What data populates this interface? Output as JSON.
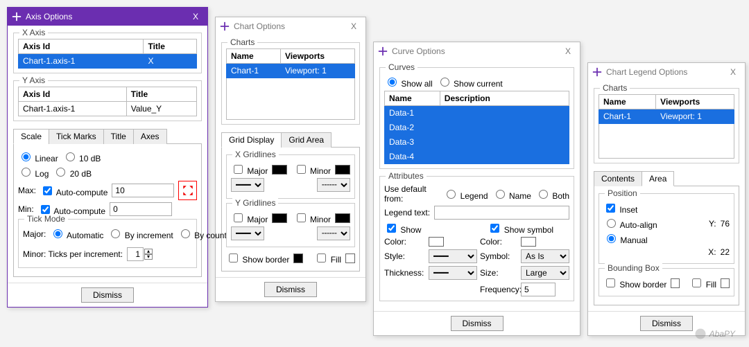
{
  "axis": {
    "title": "Axis Options",
    "close": "X",
    "xaxis": {
      "label": "X Axis",
      "headers": [
        "Axis Id",
        "Title"
      ],
      "row": {
        "id": "Chart-1.axis-1",
        "title": "X"
      }
    },
    "yaxis": {
      "label": "Y Axis",
      "headers": [
        "Axis Id",
        "Title"
      ],
      "row": {
        "id": "Chart-1.axis-1",
        "title": "Value_Y"
      }
    },
    "tabs": [
      "Scale",
      "Tick Marks",
      "Title",
      "Axes"
    ],
    "scale": {
      "linear": "Linear",
      "db10": "10 dB",
      "log": "Log",
      "db20": "20 dB",
      "max": "Max:",
      "min": "Min:",
      "auto": "Auto-compute",
      "maxval": "10",
      "minval": "0"
    },
    "tickmode": {
      "label": "Tick Mode",
      "major": "Major:",
      "automatic": "Automatic",
      "byinc": "By increment",
      "bycount": "By count",
      "minor": "Minor: Ticks per increment:",
      "minorval": "1"
    },
    "dismiss": "Dismiss"
  },
  "chart": {
    "title": "Chart Options",
    "close": "X",
    "charts": {
      "label": "Charts",
      "headers": [
        "Name",
        "Viewports"
      ],
      "row": {
        "name": "Chart-1",
        "vp": "Viewport: 1"
      }
    },
    "gtabs": [
      "Grid Display",
      "Grid Area"
    ],
    "xg": {
      "label": "X Gridlines",
      "major": "Major",
      "minor": "Minor"
    },
    "yg": {
      "label": "Y Gridlines",
      "major": "Major",
      "minor": "Minor"
    },
    "showborder": "Show border",
    "fill": "Fill",
    "dismiss": "Dismiss"
  },
  "curve": {
    "title": "Curve Options",
    "close": "X",
    "curves": {
      "label": "Curves",
      "showall": "Show all",
      "showcurrent": "Show current",
      "headers": [
        "Name",
        "Description"
      ],
      "rows": [
        "Data-1",
        "Data-2",
        "Data-3",
        "Data-4"
      ]
    },
    "attr": {
      "label": "Attributes",
      "usedefault": "Use default from:",
      "legend": "Legend",
      "name": "Name",
      "both": "Both",
      "legendtext": "Legend text:",
      "show": "Show",
      "showsymbol": "Show symbol",
      "color": "Color:",
      "style": "Style:",
      "thickness": "Thickness:",
      "symbol": "Symbol:",
      "size": "Size:",
      "frequency": "Frequency:",
      "asis": "As Is",
      "large": "Large",
      "freqval": "5"
    },
    "dismiss": "Dismiss"
  },
  "legend": {
    "title": "Chart Legend Options",
    "close": "X",
    "charts": {
      "label": "Charts",
      "headers": [
        "Name",
        "Viewports"
      ],
      "row": {
        "name": "Chart-1",
        "vp": "Viewport: 1"
      }
    },
    "tabs": [
      "Contents",
      "Area"
    ],
    "pos": {
      "label": "Position",
      "inset": "Inset",
      "autoalign": "Auto-align",
      "manual": "Manual",
      "y": "Y:",
      "x": "X:",
      "yval": "76",
      "xval": "22"
    },
    "bb": {
      "label": "Bounding Box",
      "showborder": "Show border",
      "fill": "Fill"
    },
    "dismiss": "Dismiss"
  },
  "watermark": "AbaPY"
}
